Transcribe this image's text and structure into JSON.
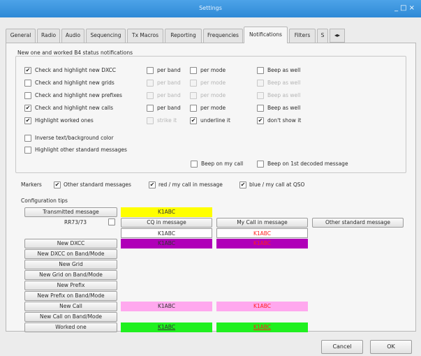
{
  "window": {
    "title": "Settings"
  },
  "tabs": [
    {
      "label": "General"
    },
    {
      "label": "Radio"
    },
    {
      "label": "Audio"
    },
    {
      "label": "Sequencing"
    },
    {
      "label": "Tx Macros"
    },
    {
      "label": "Reporting"
    },
    {
      "label": "Frequencies"
    },
    {
      "label": "Notifications"
    },
    {
      "label": "Filters"
    },
    {
      "label": "S"
    }
  ],
  "notifications_group": {
    "title": "New one and worked B4 status notifications",
    "rows": [
      {
        "label": "Check and highlight new DXCC",
        "checked": true,
        "per_band": "per band",
        "per_band_checked": false,
        "per_band_enabled": true,
        "per_mode": "per mode",
        "per_mode_checked": false,
        "per_mode_enabled": true,
        "beep": "Beep as well",
        "beep_checked": false,
        "beep_enabled": true
      },
      {
        "label": "Check and highlight new grids",
        "checked": false,
        "per_band": "per band",
        "per_band_checked": false,
        "per_band_enabled": false,
        "per_mode": "per mode",
        "per_mode_checked": false,
        "per_mode_enabled": false,
        "beep": "Beep as well",
        "beep_checked": false,
        "beep_enabled": false
      },
      {
        "label": "Check and highlight new prefixes",
        "checked": false,
        "per_band": "per band",
        "per_band_checked": false,
        "per_band_enabled": false,
        "per_mode": "per mode",
        "per_mode_checked": false,
        "per_mode_enabled": false,
        "beep": "Beep as well",
        "beep_checked": false,
        "beep_enabled": false
      },
      {
        "label": "Check and highlight new calls",
        "checked": true,
        "per_band": "per band",
        "per_band_checked": false,
        "per_band_enabled": true,
        "per_mode": "per mode",
        "per_mode_checked": false,
        "per_mode_enabled": true,
        "beep": "Beep as well",
        "beep_checked": false,
        "beep_enabled": true
      },
      {
        "label": "Highlight worked ones",
        "checked": true,
        "per_band": "strike it",
        "per_band_checked": false,
        "per_band_enabled": false,
        "per_mode": "underline it",
        "per_mode_checked": true,
        "per_mode_enabled": true,
        "beep": "don't show it",
        "beep_checked": true,
        "beep_enabled": true
      }
    ],
    "inverse_label": "Inverse text/background color",
    "inverse_checked": false,
    "other_label": "Highlight other standard messages",
    "other_checked": false,
    "beep_on_my_call": "Beep on my call",
    "beep_on_my_call_checked": false,
    "beep_on_first_decoded": "Beep on 1st decoded message",
    "beep_on_first_decoded_checked": false
  },
  "markers": {
    "label": "Markers",
    "items": [
      {
        "label": "Other standard messages",
        "checked": true
      },
      {
        "label": "red / my call in message",
        "checked": true
      },
      {
        "label": "blue / my call at QSO",
        "checked": true
      }
    ]
  },
  "config_tips": {
    "title": "Configuration tips",
    "transmitted_button": "Transmitted message",
    "rr73_label": "RR73/73",
    "rr73_checked": false,
    "cq_button": "CQ in message",
    "mycall_button": "My Call in message",
    "other_std_button": "Other standard message",
    "sample_call": "K1ABC",
    "buttons": [
      "New DXCC",
      "New DXCC on Band/Mode",
      "New Grid",
      "New Grid on Band/Mode",
      "New Prefix",
      "New Prefix on Band/Mode",
      "New Call",
      "New Call on Band/Mode",
      "Worked one"
    ]
  },
  "colors": {
    "transmitted_bg": "#ffff00",
    "cq_bg": "#ffffff",
    "mycall_fg": "#ff2020",
    "dxcc_bg": "#b000b8",
    "newcall_bg": "#ffa8ee",
    "worked_bg": "#20f020",
    "titlebar": "#3c96e0"
  },
  "dialog": {
    "cancel": "Cancel",
    "ok": "OK"
  }
}
